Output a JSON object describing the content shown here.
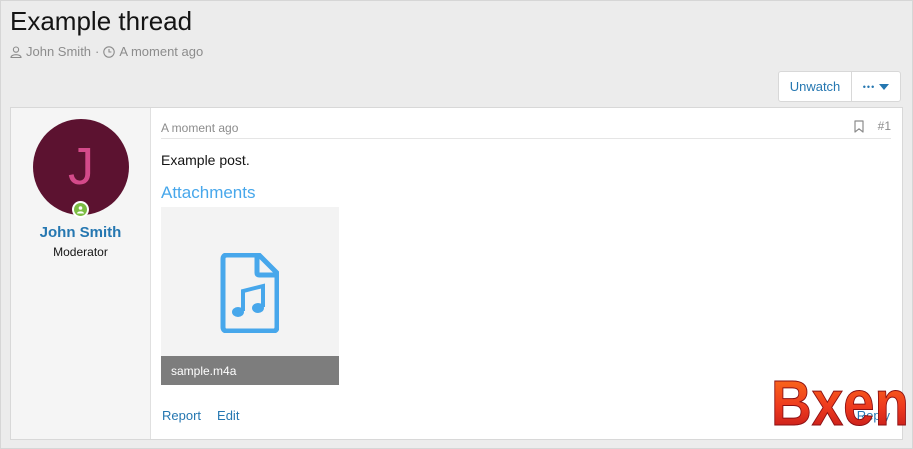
{
  "thread": {
    "title": "Example thread",
    "author": "John Smith",
    "separator": "·",
    "time": "A moment ago"
  },
  "toolbar": {
    "unwatch_label": "Unwatch",
    "more_label": "•••"
  },
  "post": {
    "avatar_letter": "J",
    "username": "John Smith",
    "user_title": "Moderator",
    "date": "A moment ago",
    "number": "#1",
    "body": "Example post.",
    "attachments_title": "Attachments",
    "attachment_name": "sample.m4a",
    "actions": {
      "report": "Report",
      "edit": "Edit",
      "reply": "Reply"
    }
  },
  "watermark": {
    "text": "Bxen"
  },
  "colors": {
    "link": "#2577b1",
    "attachments_title": "#47a7eb",
    "avatar_bg": "#5c1230",
    "avatar_letter": "#d44a8a",
    "online": "#7cbd43"
  }
}
